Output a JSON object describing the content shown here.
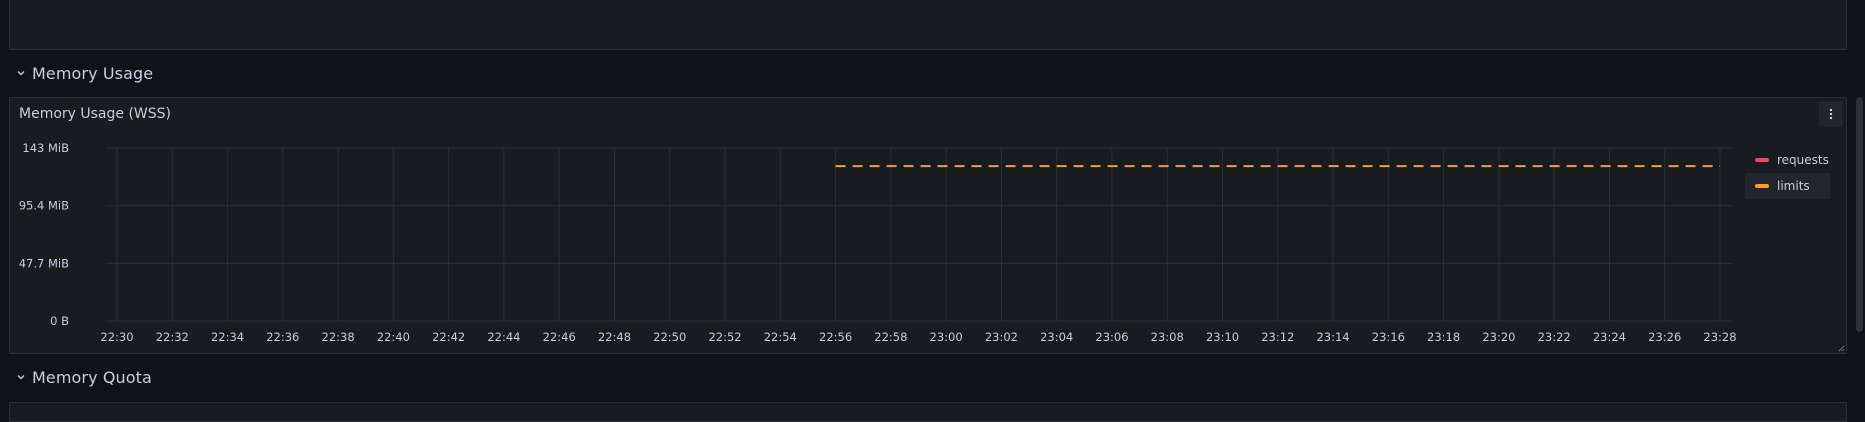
{
  "rows": {
    "memory_usage": "Memory Usage",
    "memory_quota": "Memory Quota"
  },
  "panel": {
    "title": "Memory Usage (WSS)",
    "menu_icon": "kebab-menu-icon"
  },
  "colors": {
    "requests": "#f2495c",
    "limits": "#ff9830",
    "grid": "#2c2e33",
    "axis_text": "#ccccdc"
  },
  "chart_data": {
    "type": "line",
    "x": [
      "22:30",
      "22:32",
      "22:34",
      "22:36",
      "22:38",
      "22:40",
      "22:42",
      "22:44",
      "22:46",
      "22:48",
      "22:50",
      "22:52",
      "22:54",
      "22:56",
      "22:58",
      "23:00",
      "23:02",
      "23:04",
      "23:06",
      "23:08",
      "23:10",
      "23:12",
      "23:14",
      "23:16",
      "23:18",
      "23:20",
      "23:22",
      "23:24",
      "23:26",
      "23:28"
    ],
    "y_ticks": [
      "0 B",
      "47.7 MiB",
      "95.4 MiB",
      "143 MiB"
    ],
    "ylim": [
      0,
      143
    ],
    "y_unit": "MiB",
    "series": [
      {
        "name": "requests",
        "values": []
      },
      {
        "name": "limits",
        "style": "dashed",
        "start": "22:56",
        "end": "23:28",
        "value": 128
      }
    ],
    "grid": true,
    "legend": "right"
  }
}
